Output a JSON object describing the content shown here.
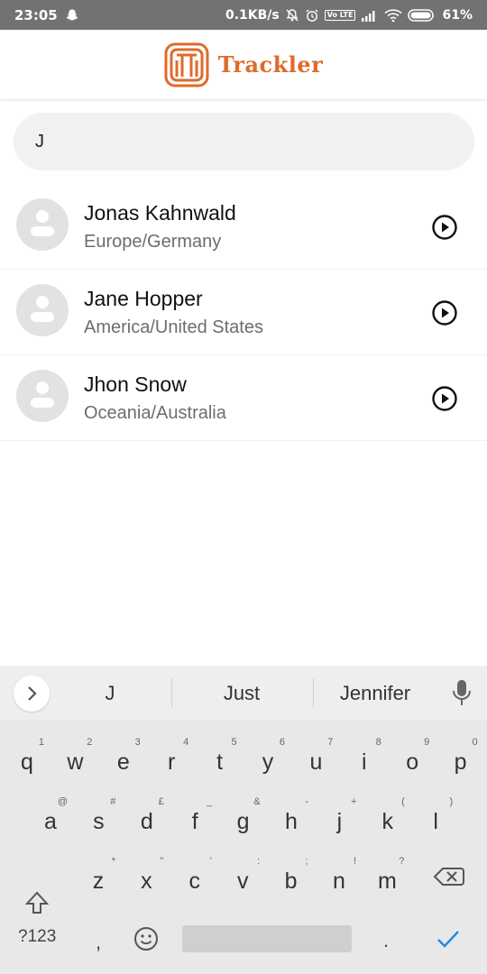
{
  "status_bar": {
    "time": "23:05",
    "network_speed": "0.1KB/s",
    "volte_label": "Vo LTE",
    "battery": "61%"
  },
  "header": {
    "app_name": "Trackler",
    "logo_color": "#e06a2b"
  },
  "search": {
    "value": "J"
  },
  "contacts": [
    {
      "name": "Jonas Kahnwald",
      "region": "Europe/Germany"
    },
    {
      "name": "Jane Hopper",
      "region": "America/United States"
    },
    {
      "name": "Jhon Snow",
      "region": "Oceania/Australia"
    }
  ],
  "keyboard": {
    "suggestions": [
      "J",
      "Just",
      "Jennifer"
    ],
    "row1": [
      {
        "key": "q",
        "hint": "1"
      },
      {
        "key": "w",
        "hint": "2"
      },
      {
        "key": "e",
        "hint": "3"
      },
      {
        "key": "r",
        "hint": "4"
      },
      {
        "key": "t",
        "hint": "5"
      },
      {
        "key": "y",
        "hint": "6"
      },
      {
        "key": "u",
        "hint": "7"
      },
      {
        "key": "i",
        "hint": "8"
      },
      {
        "key": "o",
        "hint": "9"
      },
      {
        "key": "p",
        "hint": "0"
      }
    ],
    "row2": [
      {
        "key": "a",
        "hint": "@"
      },
      {
        "key": "s",
        "hint": "#"
      },
      {
        "key": "d",
        "hint": "£"
      },
      {
        "key": "f",
        "hint": "_"
      },
      {
        "key": "g",
        "hint": "&"
      },
      {
        "key": "h",
        "hint": "-"
      },
      {
        "key": "j",
        "hint": "+"
      },
      {
        "key": "k",
        "hint": "("
      },
      {
        "key": "l",
        "hint": ")"
      }
    ],
    "row3": [
      {
        "key": "z",
        "hint": "*"
      },
      {
        "key": "x",
        "hint": "\""
      },
      {
        "key": "c",
        "hint": "'"
      },
      {
        "key": "v",
        "hint": ":"
      },
      {
        "key": "b",
        "hint": ";"
      },
      {
        "key": "n",
        "hint": "!"
      },
      {
        "key": "m",
        "hint": "?"
      }
    ],
    "symbols_label": "?123",
    "comma": ",",
    "period": ".",
    "accent_color": "#1e88e5"
  }
}
